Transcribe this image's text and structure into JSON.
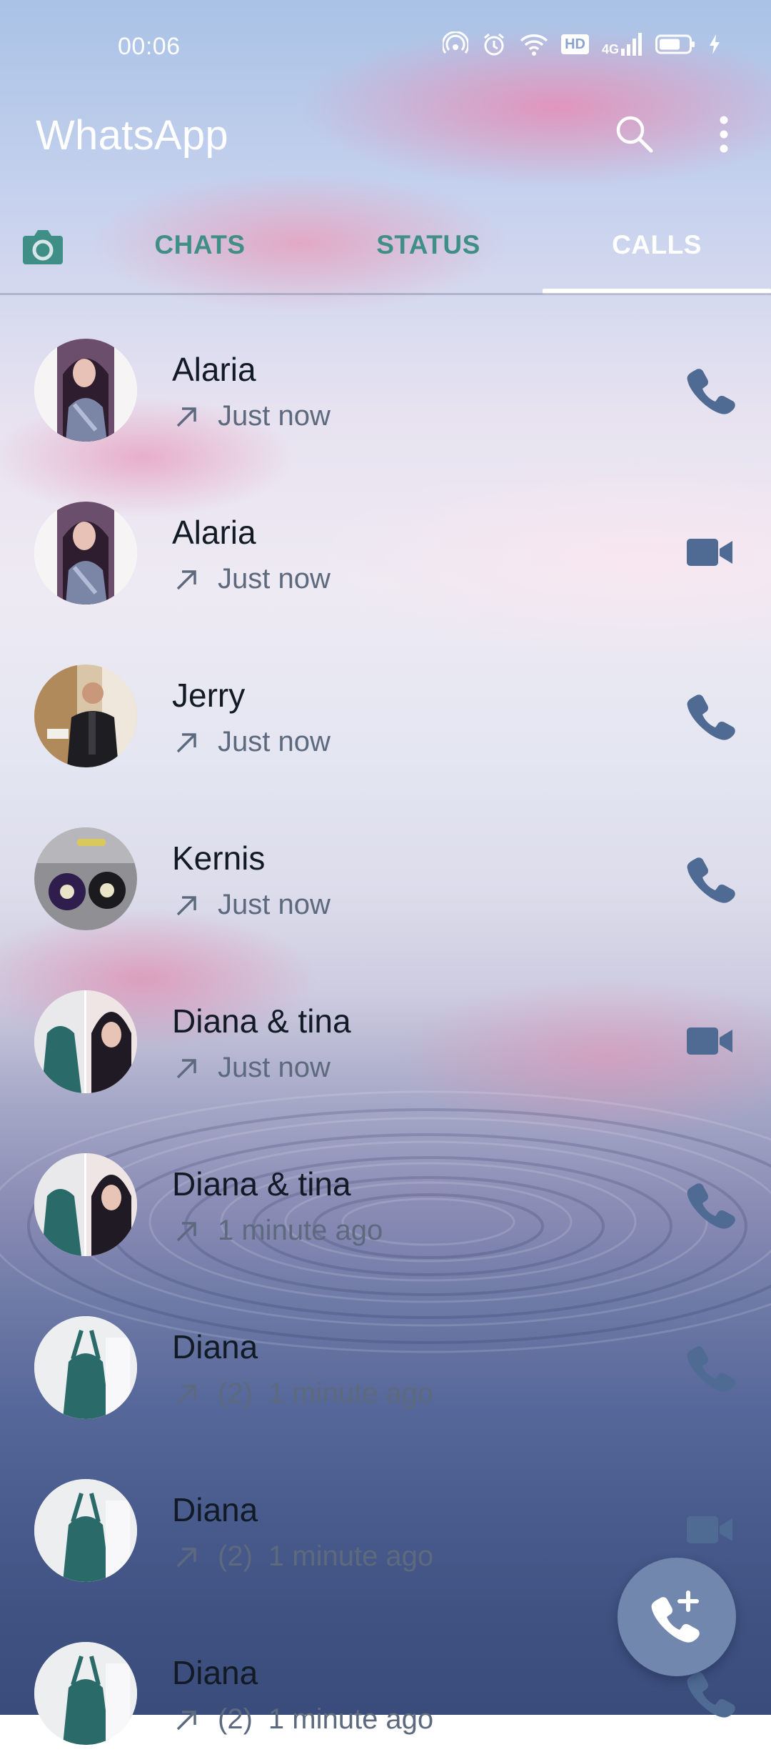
{
  "status_bar": {
    "time": "00:06",
    "icons": [
      "hotspot-icon",
      "alarm-icon",
      "wifi-icon",
      "hd-icon",
      "4g-signal-icon",
      "battery-icon",
      "charging-icon"
    ],
    "hd_label": "HD",
    "network_label": "4G"
  },
  "header": {
    "title": "WhatsApp",
    "search_icon": "search-icon",
    "menu_icon": "more-vertical-icon"
  },
  "tabs": {
    "camera_icon": "camera-icon",
    "items": [
      {
        "label": "CHATS",
        "active": false
      },
      {
        "label": "STATUS",
        "active": false
      },
      {
        "label": "CALLS",
        "active": true
      }
    ]
  },
  "calls": [
    {
      "name": "Alaria",
      "direction": "outgoing",
      "count": "",
      "time": "Just now",
      "type": "voice"
    },
    {
      "name": "Alaria",
      "direction": "outgoing",
      "count": "",
      "time": "Just now",
      "type": "video"
    },
    {
      "name": "Jerry",
      "direction": "outgoing",
      "count": "",
      "time": "Just now",
      "type": "voice"
    },
    {
      "name": "Kernis",
      "direction": "outgoing",
      "count": "",
      "time": "Just now",
      "type": "voice"
    },
    {
      "name": "Diana & tina",
      "direction": "outgoing",
      "count": "",
      "time": "Just now",
      "type": "video"
    },
    {
      "name": "Diana & tina",
      "direction": "outgoing",
      "count": "",
      "time": "1 minute ago",
      "type": "voice"
    },
    {
      "name": "Diana",
      "direction": "outgoing",
      "count": "(2)",
      "time": "1 minute ago",
      "type": "voice"
    },
    {
      "name": "Diana",
      "direction": "outgoing",
      "count": "(2)",
      "time": "1 minute ago",
      "type": "video"
    },
    {
      "name": "Diana",
      "direction": "outgoing",
      "count": "(2)",
      "time": "1 minute ago",
      "type": "voice"
    }
  ],
  "fab": {
    "icon": "add-call-icon"
  },
  "colors": {
    "accent_teal": "#3f8f86",
    "icon_blue": "#4f6b93",
    "fab_bg": "#7287ad",
    "text_primary": "#121a26",
    "text_secondary": "#5d6a7e"
  }
}
